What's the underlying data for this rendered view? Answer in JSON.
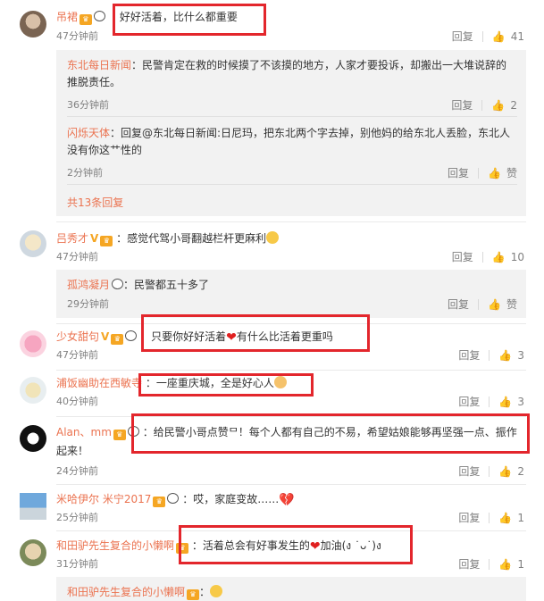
{
  "like_icon": "thumbs-up-icon",
  "reply_label": "回复",
  "comments": [
    {
      "user": "吊裙",
      "text": "好好活着，比什么都重要",
      "time": "47分钟前",
      "likes": "41",
      "replies": [
        {
          "user": "东北每日新闻",
          "text": "：民警肯定在救的时候摸了不该摸的地方，人家才要投诉，却搬出一大堆说辞的推脱责任。",
          "time": "36分钟前",
          "likes": "2"
        },
        {
          "user": "闪烁天体",
          "text": "：回复@东北每日新闻:日尼玛，把东北两个字去掉，别他妈的给东北人丢脸，东北人没有你这艹性的",
          "time": "2分钟前",
          "likes": "赞"
        }
      ],
      "more": "共13条回复"
    },
    {
      "user": "吕秀才",
      "text": "：感觉代驾小哥翻越栏杆更麻利",
      "time": "47分钟前",
      "likes": "10",
      "replies": [
        {
          "user": "孤鸿凝月",
          "text": "：民警都五十多了",
          "time": "29分钟前",
          "likes": "赞"
        }
      ]
    },
    {
      "user": "少女甜句",
      "text_a": "：只要你好好活着",
      "text_b": "有什么比活着更重吗",
      "time": "47分钟前",
      "likes": "3"
    },
    {
      "user": "浦饭幽助在西敏寺",
      "text": "：一座重庆城，全是好心人",
      "time": "40分钟前",
      "likes": "3"
    },
    {
      "user": "Alan、mm",
      "text": "：给民警小哥点赞ᄆ！每个人都有自己的不易，希望姑娘能够再坚强一点、振作起来！",
      "time": "24分钟前",
      "likes": "2"
    },
    {
      "user": "米哈伊尔 米宁2017",
      "text": "：哎，家庭变故……",
      "time": "25分钟前",
      "likes": "1"
    },
    {
      "user": "和田驴先生复合的小懒啊",
      "text_a": "：活着总会有好事发生的",
      "text_b": "加油(ง ˙ᴗ˙)ง",
      "time": "31分钟前",
      "likes": "1"
    },
    {
      "user": "和田驴先生复合的小懒啊"
    }
  ]
}
